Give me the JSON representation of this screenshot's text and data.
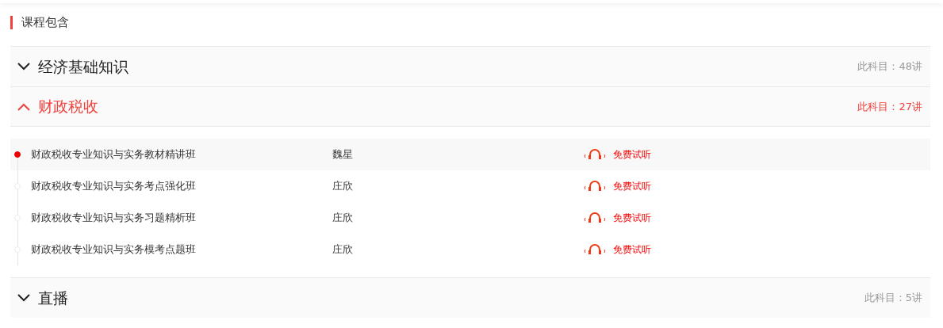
{
  "heading": "课程包含",
  "sections": [
    {
      "title": "经济基础知识",
      "count": "此科目：48讲",
      "expanded": false
    },
    {
      "title": "财政税收",
      "count": "此科目：27讲",
      "expanded": true,
      "lessons": [
        {
          "title": "财政税收专业知识与实务教材精讲班",
          "teacher": "魏星",
          "trial": "免费试听",
          "selected": true
        },
        {
          "title": "财政税收专业知识与实务考点强化班",
          "teacher": "庄欣",
          "trial": "免费试听",
          "selected": false
        },
        {
          "title": "财政税收专业知识与实务习题精析班",
          "teacher": "庄欣",
          "trial": "免费试听",
          "selected": false
        },
        {
          "title": "财政税收专业知识与实务模考点题班",
          "teacher": "庄欣",
          "trial": "免费试听",
          "selected": false
        }
      ]
    },
    {
      "title": "直播",
      "count": "此科目：5讲",
      "expanded": false
    }
  ]
}
